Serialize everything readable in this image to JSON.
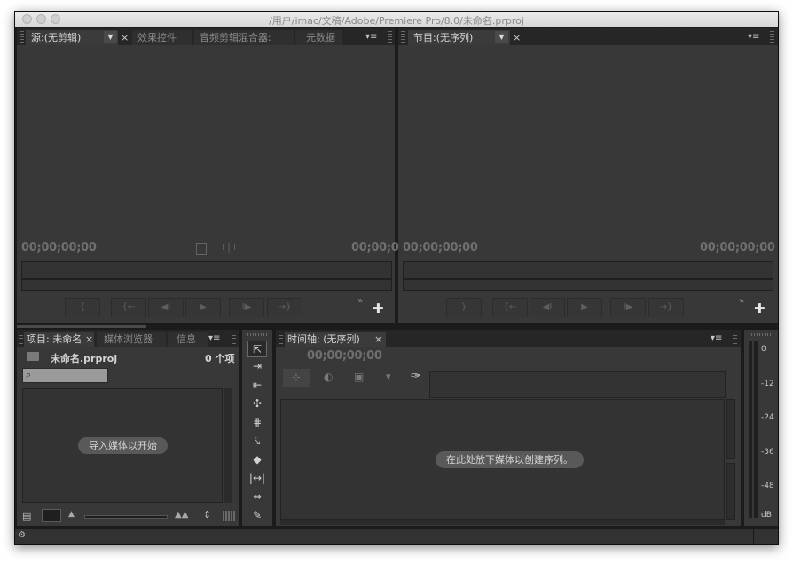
{
  "window": {
    "title": "/用户/imac/文稿/Adobe/Premiere Pro/8.0/未命名.prproj"
  },
  "source_panel": {
    "tabs": [
      "源:(无剪辑)",
      "效果控件",
      "音频剪辑混合器:",
      "元数据"
    ],
    "close_glyph": "×",
    "dropdown_glyph": "▼",
    "menu_glyph": "▾≡",
    "timecode_left": "00;00;00;00",
    "timecode_right": "00;00;0",
    "buttons": [
      "{",
      "{←",
      "◀I",
      "▶",
      "I▶",
      "→}"
    ],
    "more_glyph": "»",
    "add_glyph": "✚"
  },
  "program_panel": {
    "tabs": [
      "节目:(无序列)"
    ],
    "close_glyph": "×",
    "dropdown_glyph": "▼",
    "menu_glyph": "▾≡",
    "timecode_left": "00;00;00;00",
    "timecode_right": "00;00;00;00",
    "buttons": [
      "}",
      "{←",
      "◀I",
      "▶",
      "I▶",
      "→}"
    ],
    "more_glyph": "»",
    "add_glyph": "✚"
  },
  "project_panel": {
    "tabs": [
      "项目: 未命名",
      "媒体浏览器",
      "信息"
    ],
    "close_glyph": "×",
    "menu_glyph": "▾≡",
    "filename": "未命名.prproj",
    "item_count": "0 个项",
    "search_placeholder": "",
    "empty_hint": "导入媒体以开始"
  },
  "timeline_panel": {
    "tab": "时间轴: (无序列)",
    "close_glyph": "×",
    "menu_glyph": "▾≡",
    "timecode": "00;00;00;00",
    "empty_hint": "在此处放下媒体以创建序列。"
  },
  "audio_meter": {
    "ticks": [
      "0",
      "-12",
      "-24",
      "-36",
      "-48",
      "dB"
    ]
  }
}
